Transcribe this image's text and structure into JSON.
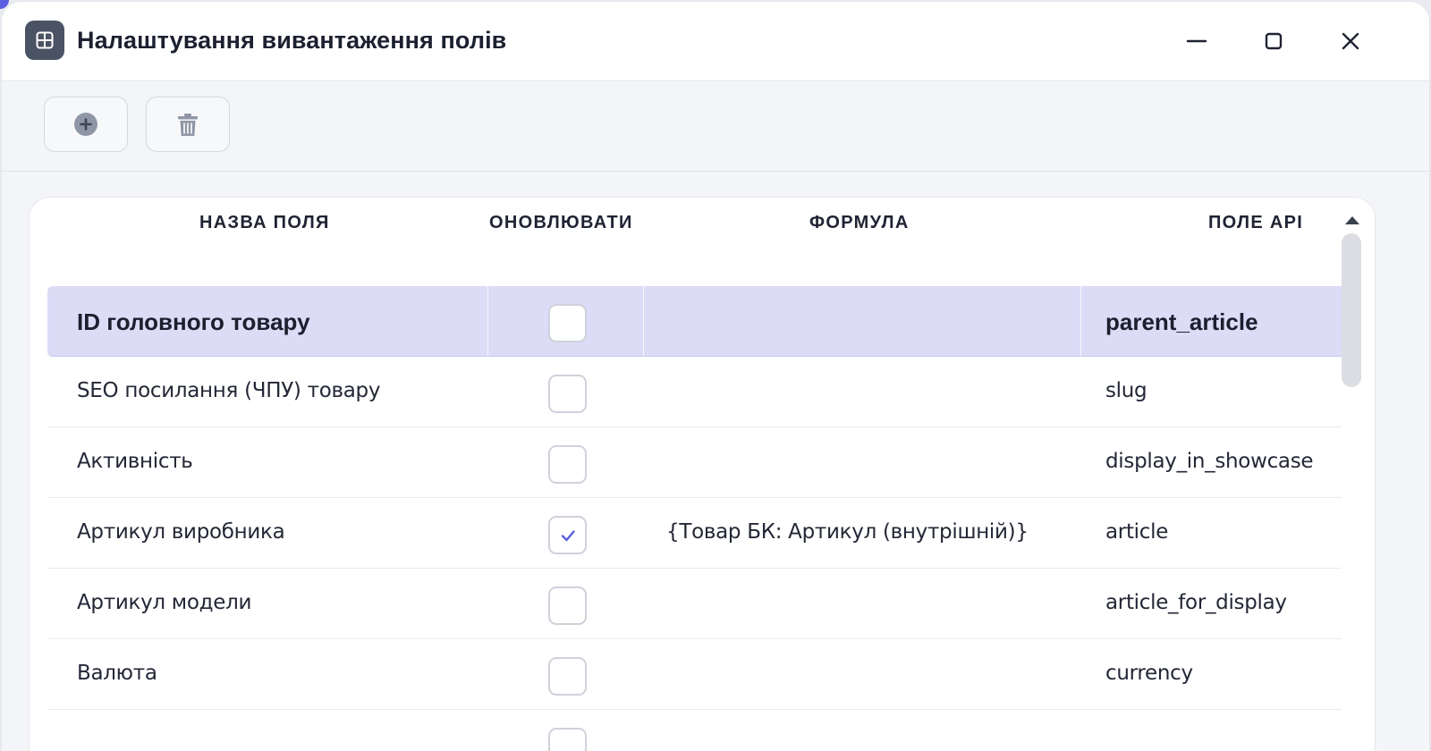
{
  "window": {
    "title": "Налаштування вивантаження полів",
    "icon": "grid-icon",
    "controls": [
      "minimize-icon",
      "maximize-icon",
      "close-icon"
    ]
  },
  "toolbar": {
    "buttons": [
      {
        "icon": "plus-circle-icon",
        "action": "add"
      },
      {
        "icon": "trash-icon",
        "action": "delete"
      }
    ]
  },
  "table": {
    "columns": [
      "НАЗВА ПОЛЯ",
      "ОНОВЛЮВАТИ",
      "ФОРМУЛА",
      "ПОЛЕ API"
    ],
    "rows": [
      {
        "name": "ID головного товару",
        "update": false,
        "formula": "",
        "api": "parent_article",
        "selected": true
      },
      {
        "name": "SEO посилання (ЧПУ) товару",
        "update": false,
        "formula": "",
        "api": "slug",
        "selected": false
      },
      {
        "name": "Активність",
        "update": false,
        "formula": "",
        "api": "display_in_showcase",
        "selected": false
      },
      {
        "name": "Артикул виробника",
        "update": true,
        "formula": "{Товар БК: Артикул (внутрішній)}",
        "api": "article",
        "selected": false
      },
      {
        "name": "Артикул модели",
        "update": false,
        "formula": "",
        "api": "article_for_display",
        "selected": false
      },
      {
        "name": "Валюта",
        "update": false,
        "formula": "",
        "api": "currency",
        "selected": false
      }
    ]
  },
  "colors": {
    "accent": "#5b5fe0",
    "selected_row": "#dcdcf7",
    "check": "#5b5fe0",
    "icon_dark": "#4a5364"
  }
}
